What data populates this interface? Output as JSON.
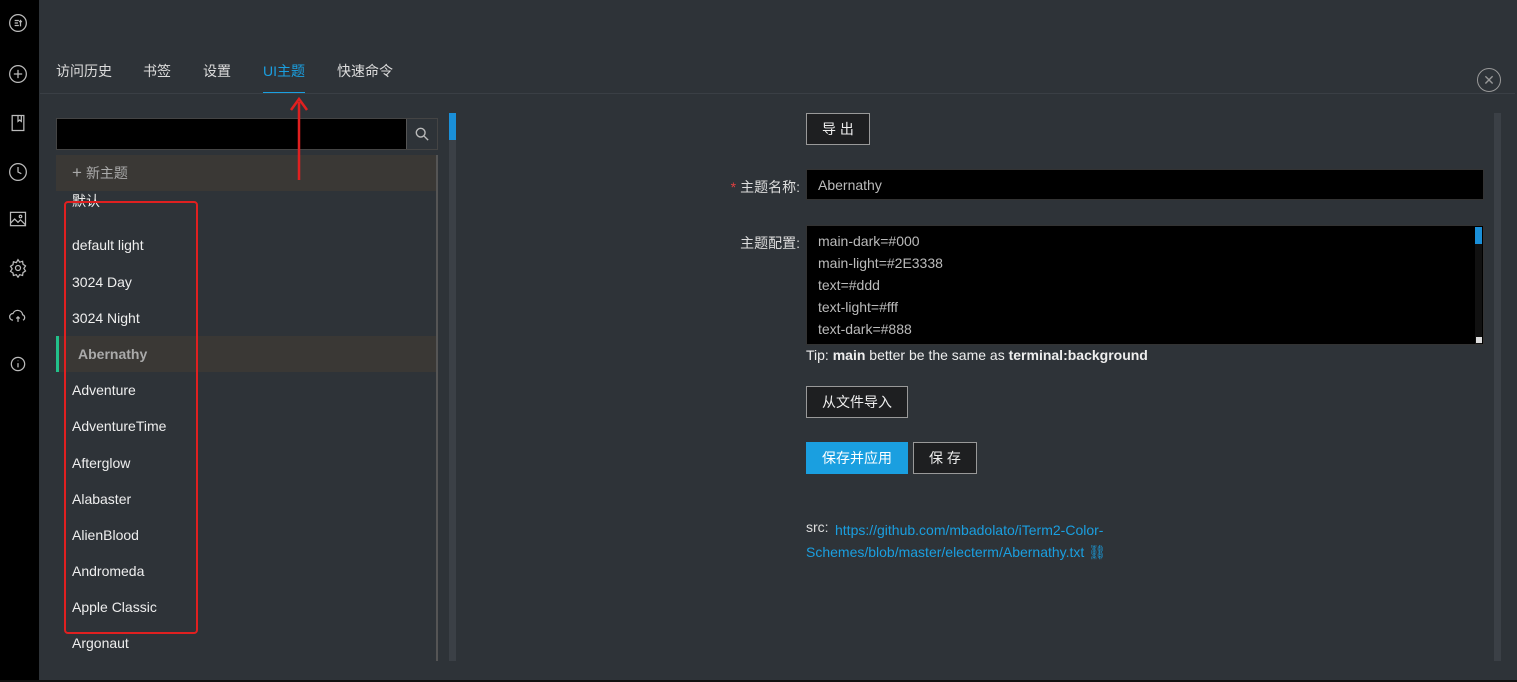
{
  "rail": {
    "icons": [
      "logo-icon",
      "add-icon",
      "bookmark-icon",
      "history-icon",
      "image-icon",
      "settings-icon",
      "cloud-sync-icon",
      "info-icon"
    ]
  },
  "tabs": [
    {
      "label": "访问历史"
    },
    {
      "label": "书签"
    },
    {
      "label": "设置"
    },
    {
      "label": "UI主题"
    },
    {
      "label": "快速命令"
    }
  ],
  "active_tab": "UI主题",
  "search": {
    "value": "",
    "placeholder": ""
  },
  "new_theme_label": "新主题",
  "themes": [
    {
      "name": "默认"
    },
    {
      "name": "default light"
    },
    {
      "name": "3024 Day"
    },
    {
      "name": "3024 Night"
    },
    {
      "name": "Abernathy"
    },
    {
      "name": "Adventure"
    },
    {
      "name": "AdventureTime"
    },
    {
      "name": "Afterglow"
    },
    {
      "name": "Alabaster"
    },
    {
      "name": "AlienBlood"
    },
    {
      "name": "Andromeda"
    },
    {
      "name": "Apple Classic"
    },
    {
      "name": "Argonaut"
    }
  ],
  "selected_theme": "Abernathy",
  "form": {
    "export_label": "导 出",
    "name_label": "主题名称:",
    "name_value": "Abernathy",
    "config_label": "主题配置:",
    "config_lines": [
      "main-dark=#000",
      "main-light=#2E3338",
      "text=#ddd",
      "text-light=#fff",
      "text-dark=#888"
    ],
    "tip_prefix": "Tip: ",
    "tip_bold1": "main",
    "tip_mid": " better be the same as ",
    "tip_bold2": "terminal:background",
    "import_label": "从文件导入",
    "save_apply_label": "保存并应用",
    "save_label": "保 存",
    "src_label": "src:",
    "src_url": "https://github.com/mbadolato/iTerm2-Color-Schemes/blob/master/electerm/Abernathy.txt"
  },
  "colors": {
    "accent": "#1a9fe0",
    "active_marker": "#22c08b",
    "annotation": "#e02020",
    "background": "#2e3338"
  }
}
